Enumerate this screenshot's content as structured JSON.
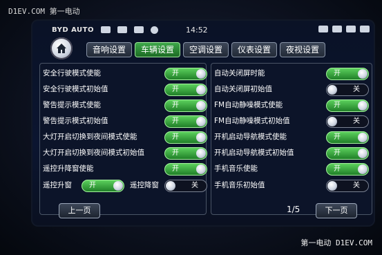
{
  "watermark": {
    "top": "D1EV.COM 第一电动",
    "bottom": "第一电动 D1EV.COM"
  },
  "statusbar": {
    "brand": "BYD AUTO",
    "time": "14:52"
  },
  "tabs": [
    {
      "label": "音响设置",
      "active": false
    },
    {
      "label": "车辆设置",
      "active": true
    },
    {
      "label": "空调设置",
      "active": false
    },
    {
      "label": "仪表设置",
      "active": false
    },
    {
      "label": "夜视设置",
      "active": false
    }
  ],
  "left_settings": [
    {
      "label": "安全行驶模式使能",
      "state": "开"
    },
    {
      "label": "安全行驶模式初始值",
      "state": "开"
    },
    {
      "label": "警告提示模式使能",
      "state": "开"
    },
    {
      "label": "警告提示模式初始值",
      "state": "开"
    },
    {
      "label": "大灯开启切换到夜间模式使能",
      "state": "开"
    },
    {
      "label": "大灯开启切换到夜间模式初始值",
      "state": "开"
    },
    {
      "label": "遥控升降窗使能",
      "state": "开"
    }
  ],
  "window_row": {
    "up_label": "遥控升窗",
    "up_state": "开",
    "down_label": "遥控降窗",
    "down_state": "关"
  },
  "right_settings": [
    {
      "label": "自动关闭屏时能",
      "state": "开"
    },
    {
      "label": "自动关闭屏初始值",
      "state": "关"
    },
    {
      "label": "FM自动静噪模式使能",
      "state": "开"
    },
    {
      "label": "FM自动静噪模式初始值",
      "state": "关"
    },
    {
      "label": "开机启动导航模式使能",
      "state": "开"
    },
    {
      "label": "开机启动导航模式初始值",
      "state": "开"
    },
    {
      "label": "手机音乐使能",
      "state": "开"
    },
    {
      "label": "手机音乐初始值",
      "state": "关"
    }
  ],
  "navigation": {
    "prev_label": "上一页",
    "next_label": "下一页",
    "page_indicator": "1/5"
  },
  "colors": {
    "on_green": "#3ea84a",
    "panel_bg": "#0c1429",
    "border": "#4a5566"
  }
}
